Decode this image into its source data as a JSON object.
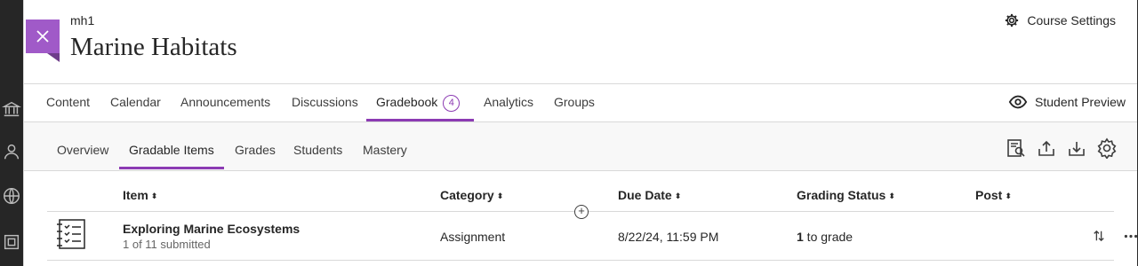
{
  "course": {
    "id": "mh1",
    "title": "Marine Habitats"
  },
  "header": {
    "course_settings": "Course Settings",
    "student_preview": "Student Preview"
  },
  "top_tabs": [
    {
      "label": "Content"
    },
    {
      "label": "Calendar"
    },
    {
      "label": "Announcements"
    },
    {
      "label": "Discussions"
    },
    {
      "label": "Gradebook",
      "badge": "4",
      "active": true
    },
    {
      "label": "Analytics"
    },
    {
      "label": "Groups"
    }
  ],
  "sub_tabs": [
    {
      "label": "Overview"
    },
    {
      "label": "Gradable Items",
      "active": true
    },
    {
      "label": "Grades"
    },
    {
      "label": "Students"
    },
    {
      "label": "Mastery"
    }
  ],
  "table": {
    "columns": [
      "Item",
      "Category",
      "Due Date",
      "Grading Status",
      "Post"
    ],
    "sort_glyph": "⬍",
    "rows": [
      {
        "name": "Exploring Marine Ecosystems",
        "submitted": "1 of 11 submitted",
        "category": "Assignment",
        "due": "8/22/24, 11:59 PM",
        "grading_count": "1",
        "grading_text": " to grade"
      }
    ]
  },
  "icons": {
    "close": "close-icon",
    "settings": "gear-icon",
    "preview": "eye-icon",
    "tools": [
      "search-document-icon",
      "upload-icon",
      "download-icon",
      "gear-icon"
    ]
  },
  "colors": {
    "accent": "#8c3bb3",
    "close_bg": "#a05ac8",
    "rail": "#262626"
  }
}
